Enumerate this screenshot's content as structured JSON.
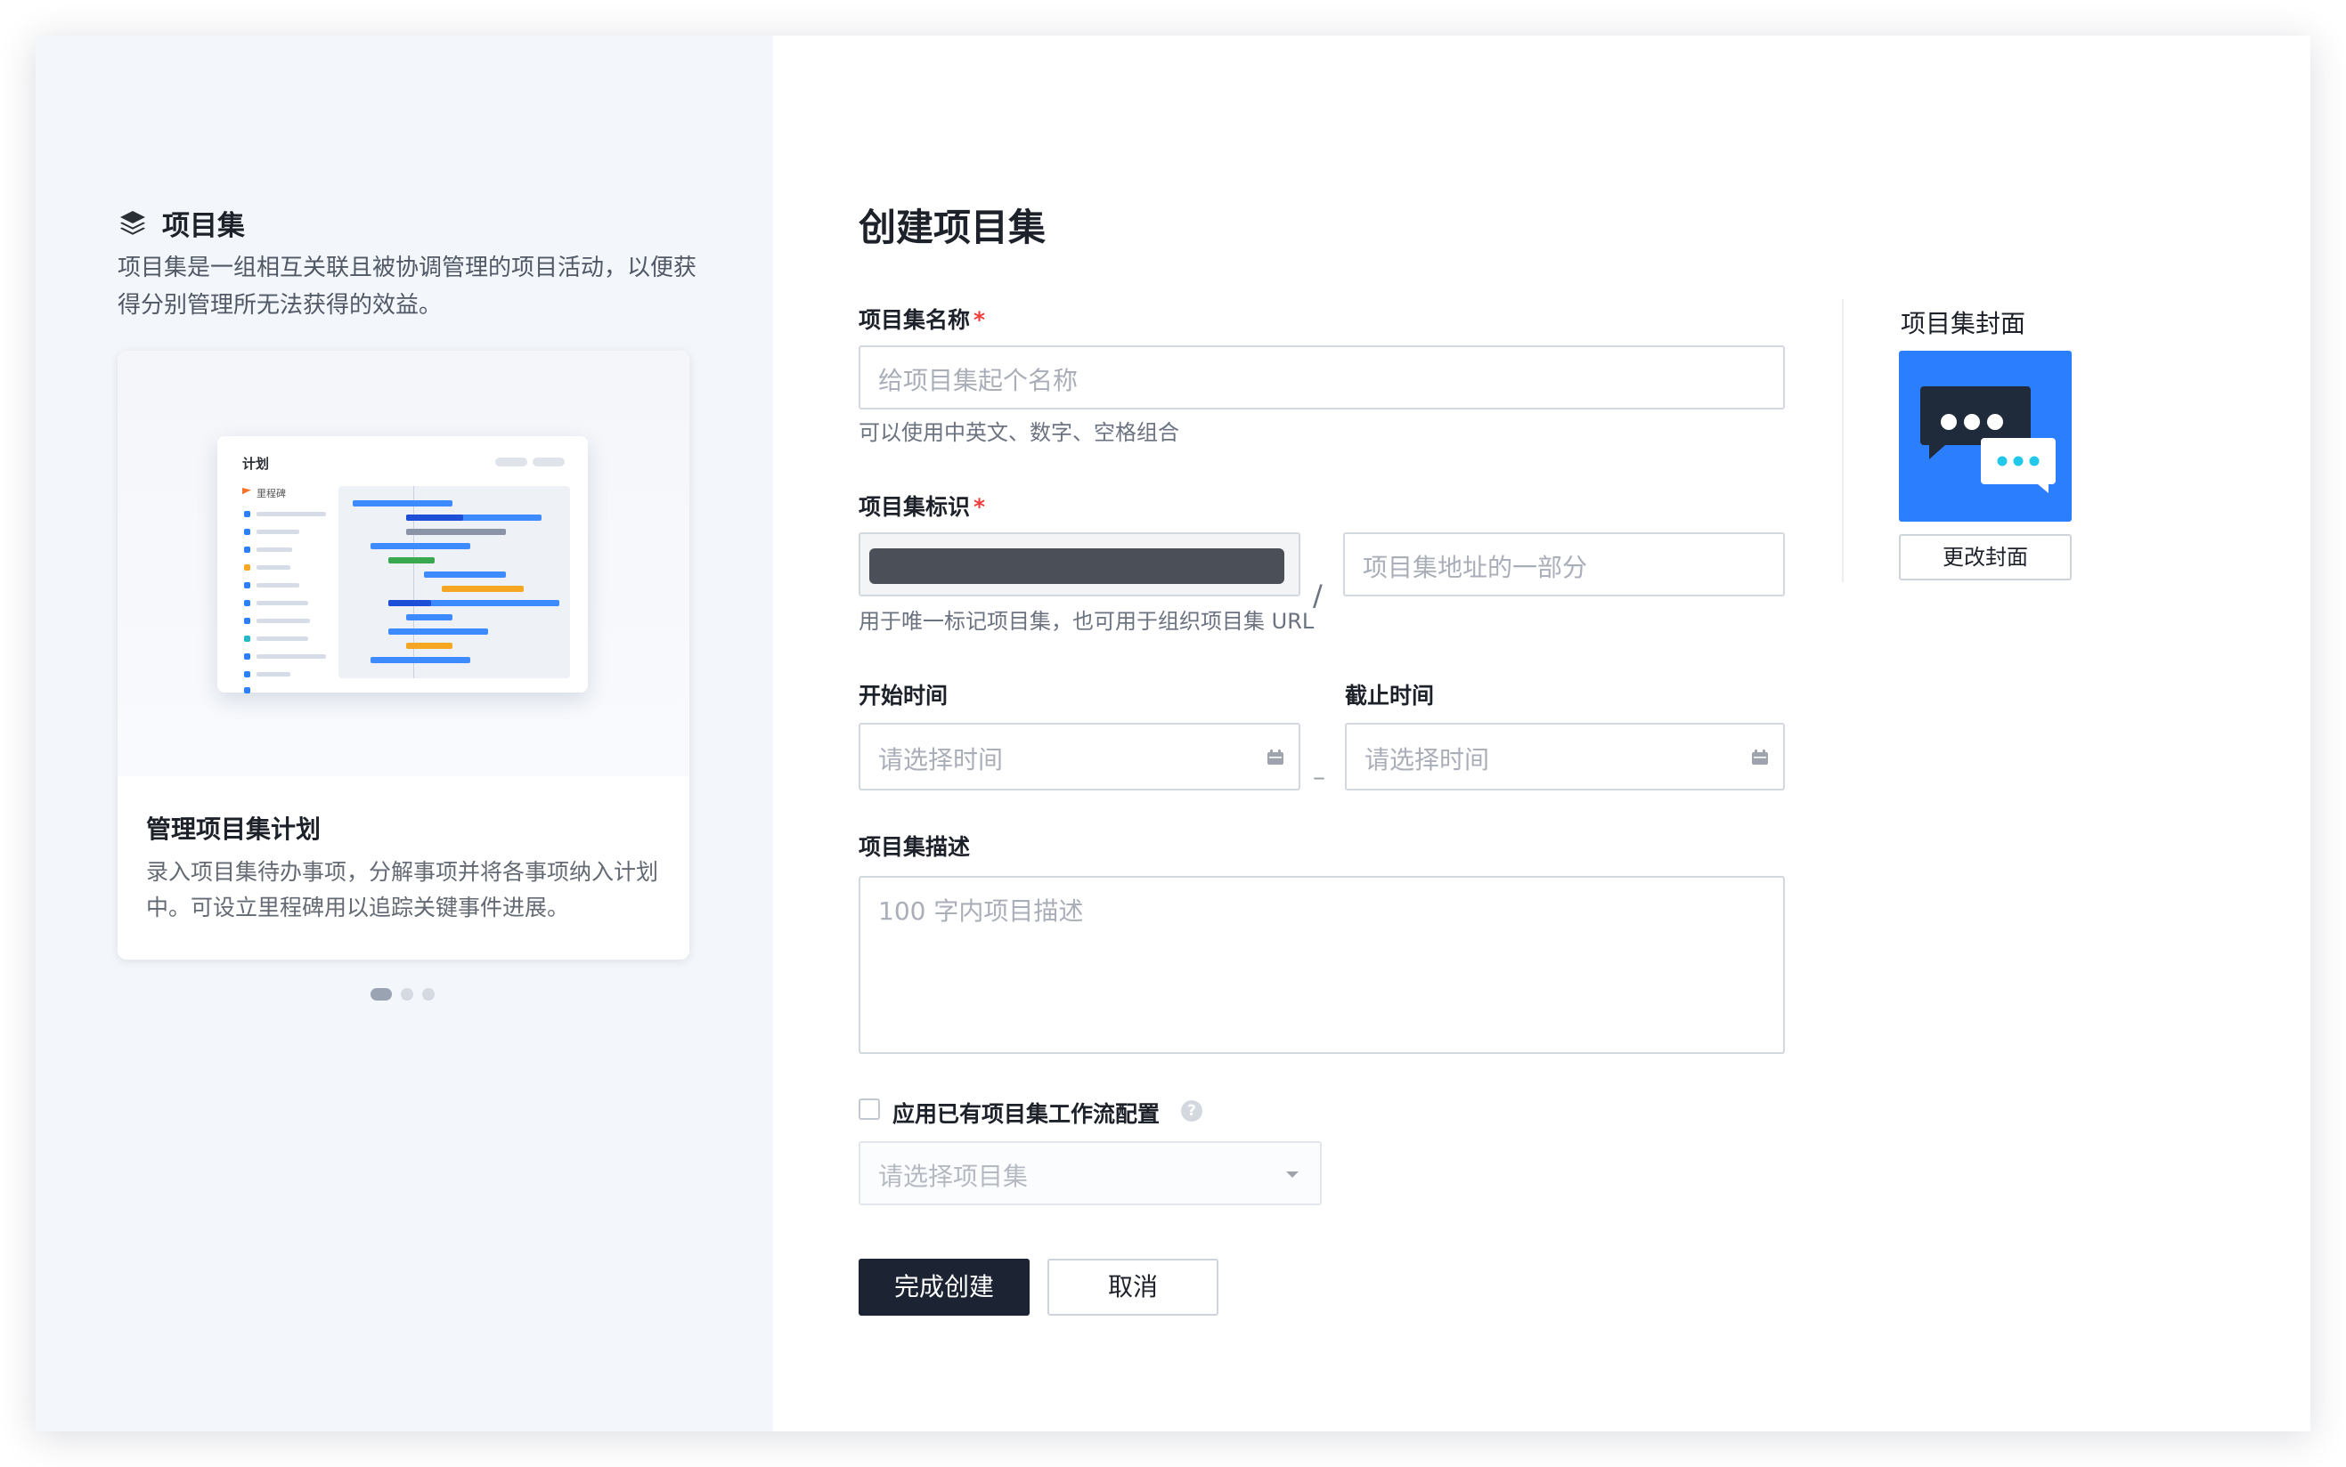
{
  "left_panel": {
    "title": "项目集",
    "description": "项目集是一组相互关联且被协调管理的项目活动，以便获得分别管理所无法获得的效益。",
    "carousel": {
      "card_title": "管理项目集计划",
      "card_description": "录入项目集待办事项，分解事项并将各事项纳入计划中。可设立里程碑用以追踪关键事件进展。",
      "illustration": {
        "mock_title": "计划",
        "milestone_label": "里程碑"
      },
      "active_index": 0,
      "total": 3
    }
  },
  "form": {
    "title": "创建项目集",
    "name": {
      "label": "项目集名称",
      "required_mark": "*",
      "placeholder": "给项目集起个名称",
      "hint": "可以使用中英文、数字、空格组合"
    },
    "identifier": {
      "label": "项目集标识",
      "required_mark": "*",
      "separator": "/",
      "placeholder": "项目集地址的一部分",
      "hint": "用于唯一标记项目集，也可用于组织项目集 URL"
    },
    "start_time": {
      "label": "开始时间",
      "placeholder": "请选择时间"
    },
    "range_separator": "–",
    "end_time": {
      "label": "截止时间",
      "placeholder": "请选择时间"
    },
    "description": {
      "label": "项目集描述",
      "placeholder": "100 字内项目描述"
    },
    "workflow": {
      "checkbox_label": "应用已有项目集工作流配置",
      "checked": false,
      "help_icon": "?",
      "select_placeholder": "请选择项目集"
    },
    "buttons": {
      "submit": "完成创建",
      "cancel": "取消"
    }
  },
  "cover": {
    "label": "项目集封面",
    "icon": "chat-bubbles-icon",
    "background_color": "#2B7FFF",
    "change_button": "更改封面"
  },
  "colors": {
    "accent": "#2B7FFF",
    "primary_button": "#1C2333",
    "required": "#F23C3C"
  }
}
